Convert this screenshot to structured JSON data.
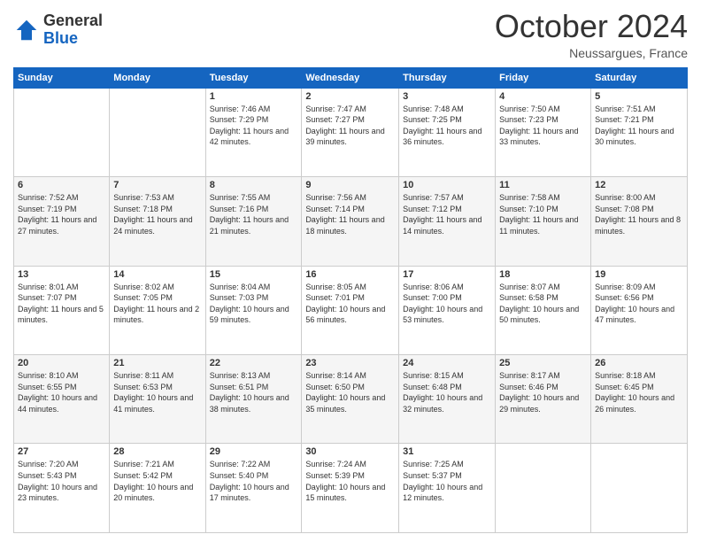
{
  "logo": {
    "general": "General",
    "blue": "Blue"
  },
  "header": {
    "month": "October 2024",
    "location": "Neussargues, France"
  },
  "days_of_week": [
    "Sunday",
    "Monday",
    "Tuesday",
    "Wednesday",
    "Thursday",
    "Friday",
    "Saturday"
  ],
  "weeks": [
    [
      {
        "day": "",
        "sunrise": "",
        "sunset": "",
        "daylight": ""
      },
      {
        "day": "",
        "sunrise": "",
        "sunset": "",
        "daylight": ""
      },
      {
        "day": "1",
        "sunrise": "Sunrise: 7:46 AM",
        "sunset": "Sunset: 7:29 PM",
        "daylight": "Daylight: 11 hours and 42 minutes."
      },
      {
        "day": "2",
        "sunrise": "Sunrise: 7:47 AM",
        "sunset": "Sunset: 7:27 PM",
        "daylight": "Daylight: 11 hours and 39 minutes."
      },
      {
        "day": "3",
        "sunrise": "Sunrise: 7:48 AM",
        "sunset": "Sunset: 7:25 PM",
        "daylight": "Daylight: 11 hours and 36 minutes."
      },
      {
        "day": "4",
        "sunrise": "Sunrise: 7:50 AM",
        "sunset": "Sunset: 7:23 PM",
        "daylight": "Daylight: 11 hours and 33 minutes."
      },
      {
        "day": "5",
        "sunrise": "Sunrise: 7:51 AM",
        "sunset": "Sunset: 7:21 PM",
        "daylight": "Daylight: 11 hours and 30 minutes."
      }
    ],
    [
      {
        "day": "6",
        "sunrise": "Sunrise: 7:52 AM",
        "sunset": "Sunset: 7:19 PM",
        "daylight": "Daylight: 11 hours and 27 minutes."
      },
      {
        "day": "7",
        "sunrise": "Sunrise: 7:53 AM",
        "sunset": "Sunset: 7:18 PM",
        "daylight": "Daylight: 11 hours and 24 minutes."
      },
      {
        "day": "8",
        "sunrise": "Sunrise: 7:55 AM",
        "sunset": "Sunset: 7:16 PM",
        "daylight": "Daylight: 11 hours and 21 minutes."
      },
      {
        "day": "9",
        "sunrise": "Sunrise: 7:56 AM",
        "sunset": "Sunset: 7:14 PM",
        "daylight": "Daylight: 11 hours and 18 minutes."
      },
      {
        "day": "10",
        "sunrise": "Sunrise: 7:57 AM",
        "sunset": "Sunset: 7:12 PM",
        "daylight": "Daylight: 11 hours and 14 minutes."
      },
      {
        "day": "11",
        "sunrise": "Sunrise: 7:58 AM",
        "sunset": "Sunset: 7:10 PM",
        "daylight": "Daylight: 11 hours and 11 minutes."
      },
      {
        "day": "12",
        "sunrise": "Sunrise: 8:00 AM",
        "sunset": "Sunset: 7:08 PM",
        "daylight": "Daylight: 11 hours and 8 minutes."
      }
    ],
    [
      {
        "day": "13",
        "sunrise": "Sunrise: 8:01 AM",
        "sunset": "Sunset: 7:07 PM",
        "daylight": "Daylight: 11 hours and 5 minutes."
      },
      {
        "day": "14",
        "sunrise": "Sunrise: 8:02 AM",
        "sunset": "Sunset: 7:05 PM",
        "daylight": "Daylight: 11 hours and 2 minutes."
      },
      {
        "day": "15",
        "sunrise": "Sunrise: 8:04 AM",
        "sunset": "Sunset: 7:03 PM",
        "daylight": "Daylight: 10 hours and 59 minutes."
      },
      {
        "day": "16",
        "sunrise": "Sunrise: 8:05 AM",
        "sunset": "Sunset: 7:01 PM",
        "daylight": "Daylight: 10 hours and 56 minutes."
      },
      {
        "day": "17",
        "sunrise": "Sunrise: 8:06 AM",
        "sunset": "Sunset: 7:00 PM",
        "daylight": "Daylight: 10 hours and 53 minutes."
      },
      {
        "day": "18",
        "sunrise": "Sunrise: 8:07 AM",
        "sunset": "Sunset: 6:58 PM",
        "daylight": "Daylight: 10 hours and 50 minutes."
      },
      {
        "day": "19",
        "sunrise": "Sunrise: 8:09 AM",
        "sunset": "Sunset: 6:56 PM",
        "daylight": "Daylight: 10 hours and 47 minutes."
      }
    ],
    [
      {
        "day": "20",
        "sunrise": "Sunrise: 8:10 AM",
        "sunset": "Sunset: 6:55 PM",
        "daylight": "Daylight: 10 hours and 44 minutes."
      },
      {
        "day": "21",
        "sunrise": "Sunrise: 8:11 AM",
        "sunset": "Sunset: 6:53 PM",
        "daylight": "Daylight: 10 hours and 41 minutes."
      },
      {
        "day": "22",
        "sunrise": "Sunrise: 8:13 AM",
        "sunset": "Sunset: 6:51 PM",
        "daylight": "Daylight: 10 hours and 38 minutes."
      },
      {
        "day": "23",
        "sunrise": "Sunrise: 8:14 AM",
        "sunset": "Sunset: 6:50 PM",
        "daylight": "Daylight: 10 hours and 35 minutes."
      },
      {
        "day": "24",
        "sunrise": "Sunrise: 8:15 AM",
        "sunset": "Sunset: 6:48 PM",
        "daylight": "Daylight: 10 hours and 32 minutes."
      },
      {
        "day": "25",
        "sunrise": "Sunrise: 8:17 AM",
        "sunset": "Sunset: 6:46 PM",
        "daylight": "Daylight: 10 hours and 29 minutes."
      },
      {
        "day": "26",
        "sunrise": "Sunrise: 8:18 AM",
        "sunset": "Sunset: 6:45 PM",
        "daylight": "Daylight: 10 hours and 26 minutes."
      }
    ],
    [
      {
        "day": "27",
        "sunrise": "Sunrise: 7:20 AM",
        "sunset": "Sunset: 5:43 PM",
        "daylight": "Daylight: 10 hours and 23 minutes."
      },
      {
        "day": "28",
        "sunrise": "Sunrise: 7:21 AM",
        "sunset": "Sunset: 5:42 PM",
        "daylight": "Daylight: 10 hours and 20 minutes."
      },
      {
        "day": "29",
        "sunrise": "Sunrise: 7:22 AM",
        "sunset": "Sunset: 5:40 PM",
        "daylight": "Daylight: 10 hours and 17 minutes."
      },
      {
        "day": "30",
        "sunrise": "Sunrise: 7:24 AM",
        "sunset": "Sunset: 5:39 PM",
        "daylight": "Daylight: 10 hours and 15 minutes."
      },
      {
        "day": "31",
        "sunrise": "Sunrise: 7:25 AM",
        "sunset": "Sunset: 5:37 PM",
        "daylight": "Daylight: 10 hours and 12 minutes."
      },
      {
        "day": "",
        "sunrise": "",
        "sunset": "",
        "daylight": ""
      },
      {
        "day": "",
        "sunrise": "",
        "sunset": "",
        "daylight": ""
      }
    ]
  ]
}
